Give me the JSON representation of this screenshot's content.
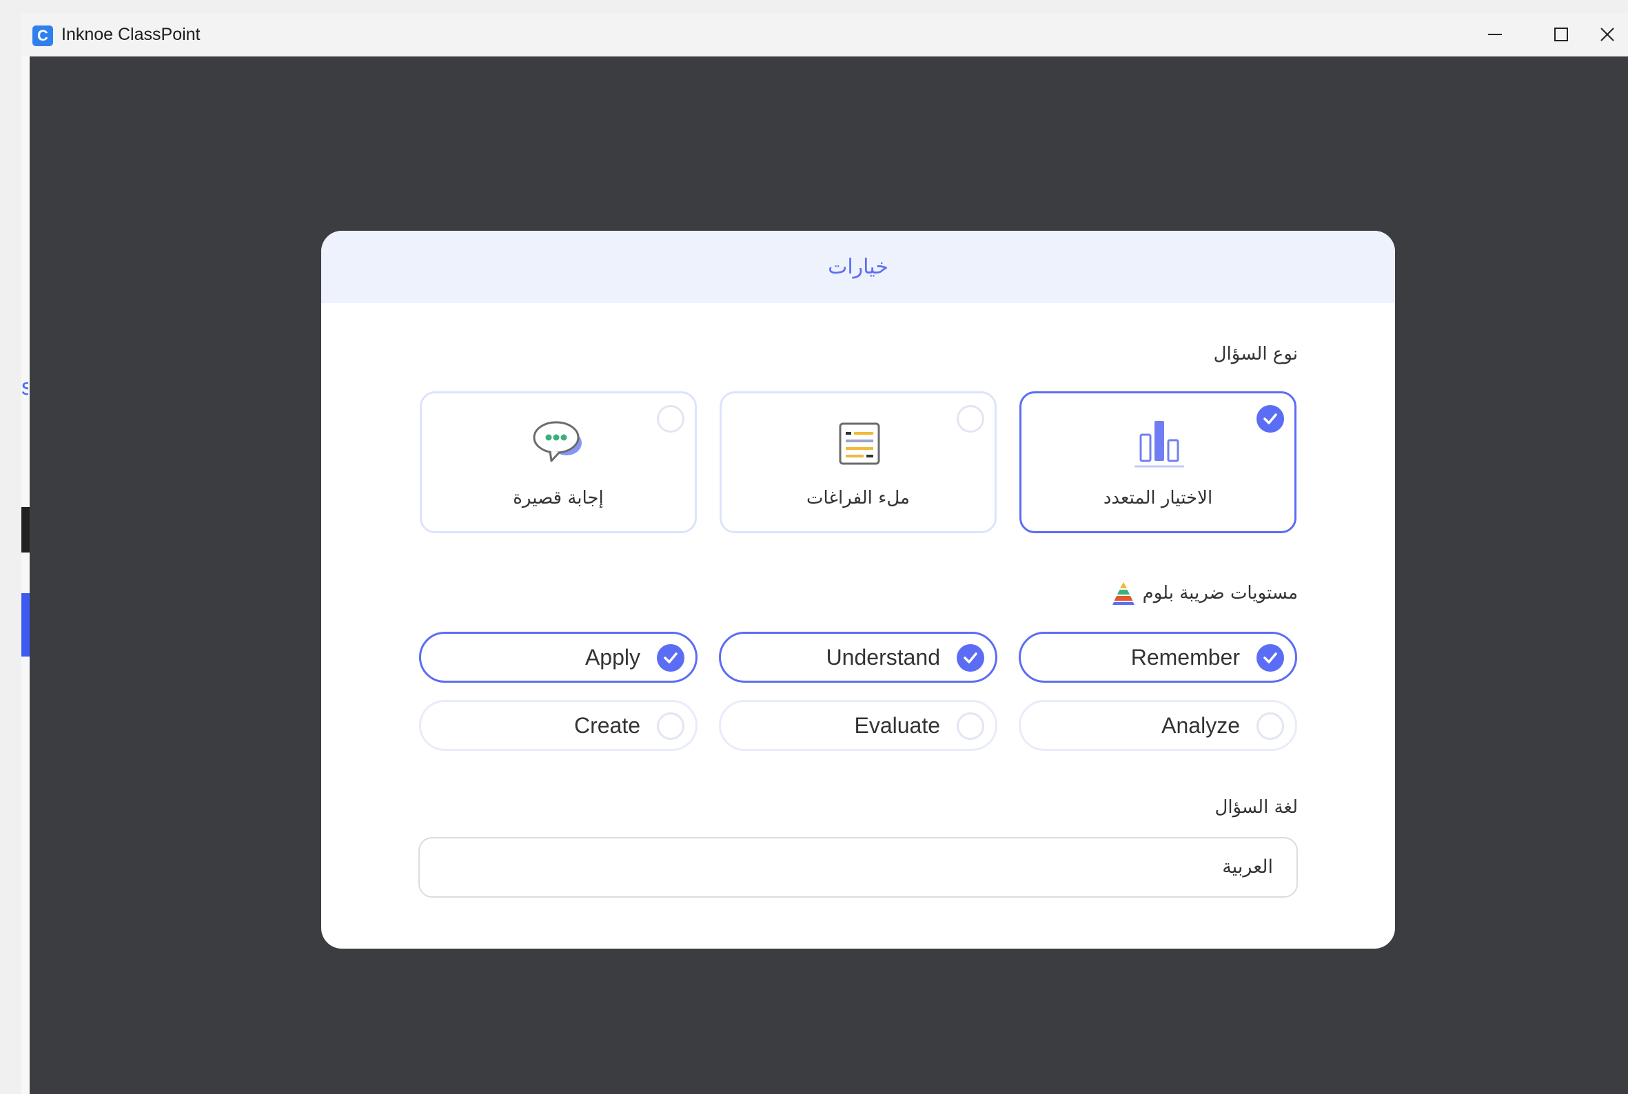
{
  "window": {
    "app_logo_letter": "C",
    "title": "Inknoe ClassPoint",
    "accent": "#5b6df5"
  },
  "background_peek": {
    "text": "s"
  },
  "dialog": {
    "title": "خيارات",
    "question_type": {
      "label": "نوع السؤال",
      "options": [
        {
          "label": "الاختيار المتعدد",
          "icon": "bar-chart-icon",
          "selected": true
        },
        {
          "label": "ملء الفراغات",
          "icon": "fill-blanks-icon",
          "selected": false
        },
        {
          "label": "إجابة قصيرة",
          "icon": "chat-bubble-icon",
          "selected": false
        }
      ]
    },
    "bloom": {
      "label": "مستويات ضريبة بلوم",
      "icon": "pyramid-icon",
      "levels": [
        {
          "label": "Remember",
          "checked": true
        },
        {
          "label": "Understand",
          "checked": true
        },
        {
          "label": "Apply",
          "checked": true
        },
        {
          "label": "Analyze",
          "checked": false
        },
        {
          "label": "Evaluate",
          "checked": false
        },
        {
          "label": "Create",
          "checked": false
        }
      ]
    },
    "language": {
      "label": "لغة السؤال",
      "value": "العربية"
    }
  }
}
